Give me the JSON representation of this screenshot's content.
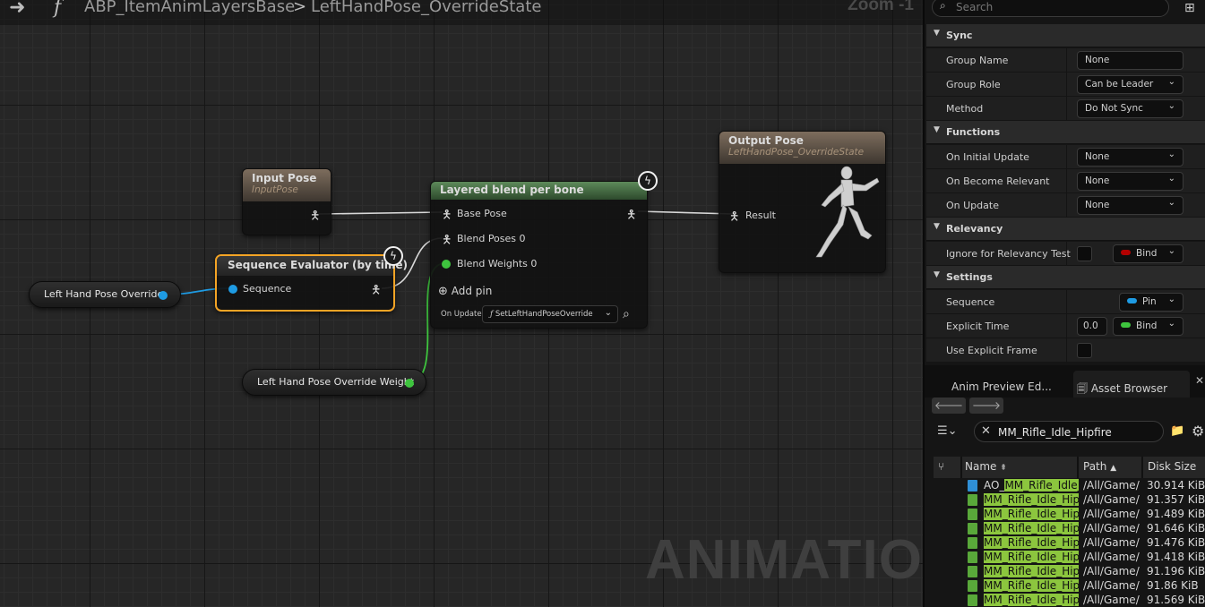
{
  "graph": {
    "breadcrumb": {
      "blueprint": "ABP_ItemAnimLayersBase",
      "separator": ">",
      "state": "LeftHandPose_OverrideState"
    },
    "zoom": "Zoom -1",
    "watermark": "ANIMATION",
    "nodes": {
      "input_pose": {
        "title": "Input Pose",
        "subtitle": "InputPose"
      },
      "output_pose": {
        "title": "Output Pose",
        "subtitle": "LeftHandPose_OverrideState",
        "result_pin": "Result"
      },
      "layered_blend": {
        "title": "Layered blend per bone",
        "pins": [
          "Base Pose",
          "Blend Poses 0",
          "Blend Weights 0"
        ],
        "add_pin": "Add pin",
        "on_update_label": "On Update",
        "on_update_function": "SetLeftHandPoseOverride"
      },
      "sequence_evaluator": {
        "title": "Sequence Evaluator (by time)",
        "pin": "Sequence"
      },
      "left_hand_pose_override": {
        "label": "Left Hand Pose Override"
      },
      "left_hand_override_weight": {
        "label": "Left Hand Pose Override Weight"
      }
    },
    "colors": {
      "sequence_pin": "#1e9be3",
      "float_pin": "#3ec43e",
      "selected_outline": "#f4a425",
      "blend_header": "#5d8a5a",
      "pose_header": "#7d6d5d"
    }
  },
  "details": {
    "search_placeholder": "Search",
    "categories": {
      "sync": "Sync",
      "functions": "Functions",
      "relevancy": "Relevancy",
      "settings": "Settings"
    },
    "properties": {
      "group_name": {
        "label": "Group Name",
        "value": "None"
      },
      "group_role": {
        "label": "Group Role",
        "value": "Can be Leader"
      },
      "method": {
        "label": "Method",
        "value": "Do Not Sync"
      },
      "on_initial_update": {
        "label": "On Initial Update",
        "value": "None"
      },
      "on_become_relevant": {
        "label": "On Become Relevant",
        "value": "None"
      },
      "on_update": {
        "label": "On Update",
        "value": "None"
      },
      "ignore_relevancy": {
        "label": "Ignore for Relevancy Test",
        "bind": "Bind"
      },
      "sequence": {
        "label": "Sequence",
        "pin": "Pin"
      },
      "explicit_time": {
        "label": "Explicit Time",
        "value": "0.0",
        "bind": "Bind"
      },
      "use_explicit_frame": {
        "label": "Use Explicit Frame"
      }
    }
  },
  "asset_browser": {
    "tabs": {
      "anim_preview": "Anim Preview Ed...",
      "asset_browser": "Asset Browser"
    },
    "search_value": "MM_Rifle_Idle_Hipfire",
    "columns": {
      "name": "Name",
      "path": "Path",
      "disk_size": "Disk Size"
    },
    "rows": [
      {
        "prefix": "AO_",
        "match": "MM_Rifle_Idle_",
        "path": "/All/Game/",
        "size": "30.914 KiB",
        "icon_color": "#2f8fd6"
      },
      {
        "prefix": "",
        "match": "MM_Rifle_Idle_Hip",
        "path": "/All/Game/",
        "size": "91.357 KiB",
        "icon_color": "#59a83a"
      },
      {
        "prefix": "",
        "match": "MM_Rifle_Idle_Hip",
        "path": "/All/Game/",
        "size": "91.489 KiB",
        "icon_color": "#59a83a"
      },
      {
        "prefix": "",
        "match": "MM_Rifle_Idle_Hip",
        "path": "/All/Game/",
        "size": "91.646 KiB",
        "icon_color": "#59a83a"
      },
      {
        "prefix": "",
        "match": "MM_Rifle_Idle_Hip",
        "path": "/All/Game/",
        "size": "91.476 KiB",
        "icon_color": "#59a83a"
      },
      {
        "prefix": "",
        "match": "MM_Rifle_Idle_Hip",
        "path": "/All/Game/",
        "size": "91.418 KiB",
        "icon_color": "#59a83a"
      },
      {
        "prefix": "",
        "match": "MM_Rifle_Idle_Hip",
        "path": "/All/Game/",
        "size": "91.196 KiB",
        "icon_color": "#59a83a"
      },
      {
        "prefix": "",
        "match": "MM_Rifle_Idle_Hip",
        "path": "/All/Game/",
        "size": "91.86 KiB",
        "icon_color": "#59a83a"
      },
      {
        "prefix": "",
        "match": "MM_Rifle_Idle_Hip",
        "path": "/All/Game/",
        "size": "91.569 KiB",
        "icon_color": "#59a83a"
      }
    ]
  }
}
